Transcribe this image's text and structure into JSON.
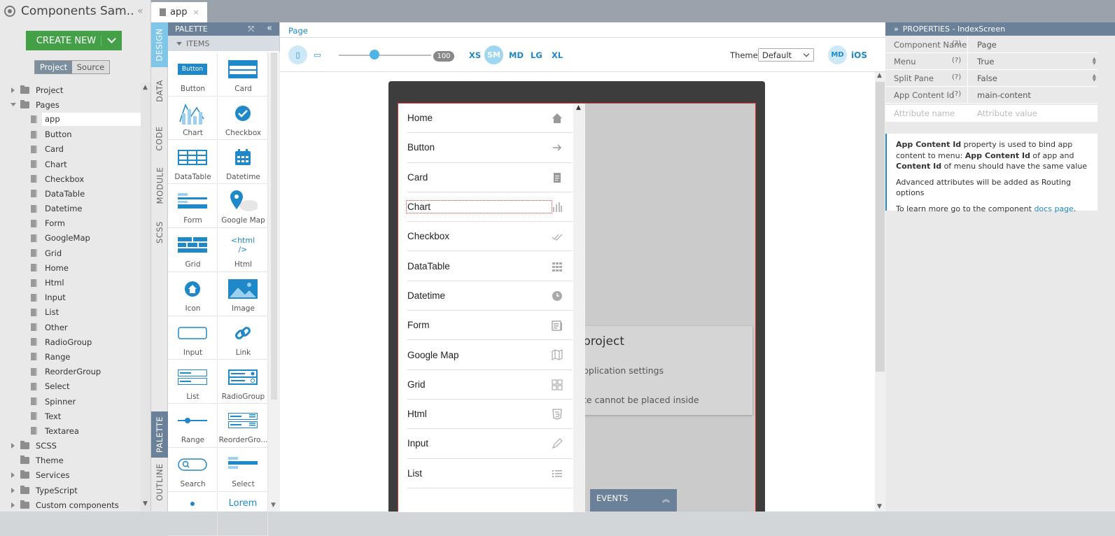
{
  "project": {
    "name": "Components Sam..."
  },
  "create_button": {
    "label": "CREATE NEW"
  },
  "view_tabs": [
    "Project",
    "Source"
  ],
  "tree": {
    "folders_top": [
      "Project",
      "Pages"
    ],
    "pages": [
      "app",
      "Button",
      "Card",
      "Chart",
      "Checkbox",
      "DataTable",
      "Datetime",
      "Form",
      "GoogleMap",
      "Grid",
      "Home",
      "Html",
      "Input",
      "List",
      "Other",
      "RadioGroup",
      "Range",
      "ReorderGroup",
      "Select",
      "Spinner",
      "Text",
      "Textarea"
    ],
    "folders_bottom": [
      "SCSS",
      "Theme",
      "Services",
      "TypeScript",
      "Custom components"
    ]
  },
  "vertical_tabs": [
    "DESIGN",
    "DATA",
    "CODE",
    "MODULE",
    "SCSS",
    "PALETTE",
    "OUTLINE"
  ],
  "palette": {
    "title": "PALETTE",
    "section": "ITEMS",
    "items": [
      "Button",
      "Card",
      "Chart",
      "Checkbox",
      "DataTable",
      "Datetime",
      "Form",
      "Google Map",
      "Grid",
      "Html",
      "Icon",
      "Image",
      "Input",
      "Link",
      "List",
      "RadioGroup",
      "Range",
      "ReorderGro...",
      "Search",
      "Select"
    ],
    "icon_text": {
      "button": "Button",
      "html": "<html />",
      "lorem": "Lorem"
    }
  },
  "editor_tab": {
    "label": "app",
    "close": "×"
  },
  "breadcrumb": "Page",
  "toolbar": {
    "zoom": "100",
    "breakpoints": [
      "XS",
      "SM",
      "MD",
      "LG",
      "XL"
    ],
    "theme_label": "Theme:",
    "theme_value": "Default",
    "platform_badge": "MD",
    "platform_ios": "iOS"
  },
  "menu_items": [
    "Home",
    "Button",
    "Card",
    "Chart",
    "Checkbox",
    "DataTable",
    "Datetime",
    "Form",
    "Google Map",
    "Grid",
    "Html",
    "Input",
    "List"
  ],
  "card": {
    "title": "project",
    "line1": "pplication settings",
    "line2": "te cannot be placed inside"
  },
  "events": {
    "label": "EVENTS"
  },
  "properties": {
    "title": "PROPERTIES - IndexScreen",
    "rows": [
      {
        "key": "Component Name",
        "help": "(?)",
        "value": "Page"
      },
      {
        "key": "Menu",
        "help": "(?)",
        "value": "True"
      },
      {
        "key": "Split Pane",
        "help": "(?)",
        "value": "False"
      },
      {
        "key": "App Content Id",
        "help": "(?)",
        "value": "main-content"
      }
    ],
    "attr_name_placeholder": "Attribute name",
    "attr_value_placeholder": "Attribute value",
    "info": {
      "p1_a": "App Content Id",
      "p1_b": " property is used to bind app content to menu: ",
      "p1_c": "App Content Id",
      "p1_d": " of app and ",
      "p1_e": "Content Id",
      "p1_f": " of menu should have the same value",
      "p2": "Advanced attributes will be added as Routing options",
      "p3_a": "To learn more go to the component ",
      "p3_link": "docs page",
      "p3_b": "."
    }
  },
  "colors": {
    "accent": "#1e88c8",
    "create": "#43a047",
    "header": "#6b8199",
    "active_tab": "#7fc6e8"
  }
}
